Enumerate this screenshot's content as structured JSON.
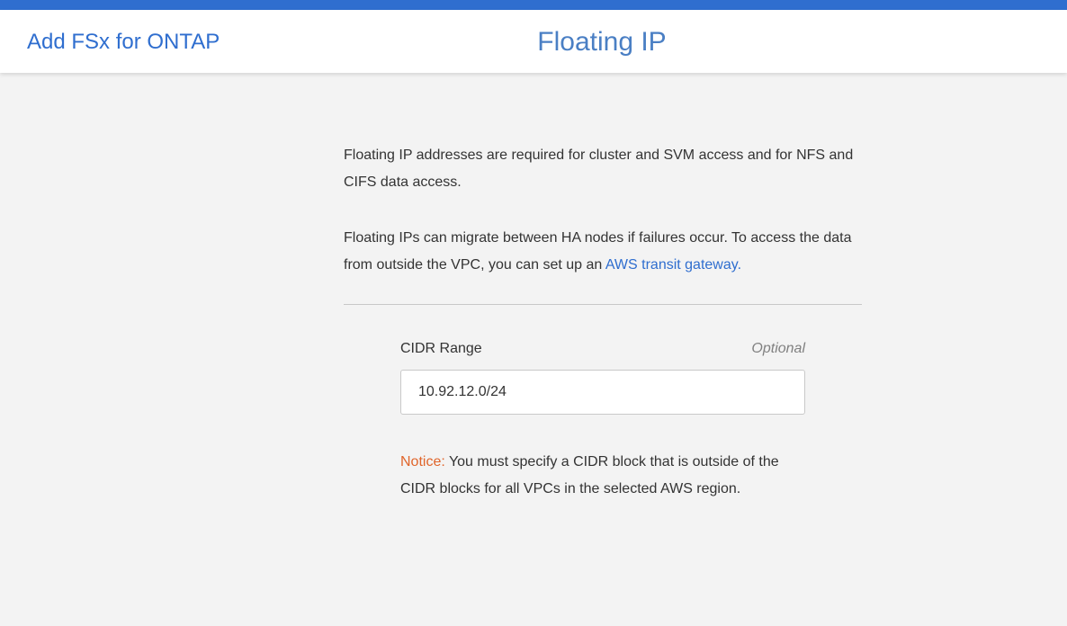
{
  "header": {
    "back_label": "Add FSx for ONTAP",
    "title": "Floating IP"
  },
  "description": {
    "paragraph1": "Floating IP addresses are required for cluster and SVM access and for NFS and CIFS data access.",
    "paragraph2_text": "Floating IPs can migrate between HA nodes if failures occur. To access the data from outside the VPC, you can set up an ",
    "paragraph2_link": "AWS transit gateway."
  },
  "cidr_field": {
    "label": "CIDR Range",
    "optional_label": "Optional",
    "value": "10.92.12.0/24"
  },
  "notice": {
    "label": "Notice:",
    "text": " You must specify a CIDR block that is outside of the CIDR blocks for all VPCs in the selected AWS region."
  },
  "colors": {
    "top_bar": "#2f6ecf",
    "link": "#2f6ecf",
    "title": "#4a7fc4",
    "notice": "#e0652b",
    "background": "#f3f3f3"
  }
}
